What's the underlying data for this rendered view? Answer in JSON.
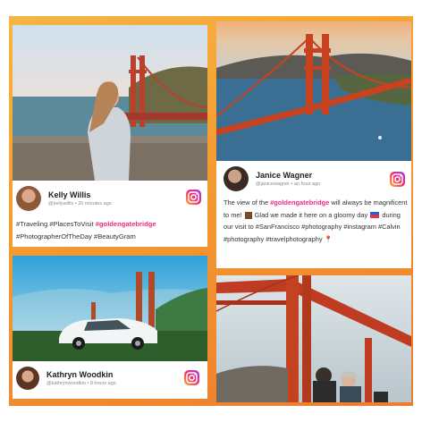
{
  "posts": [
    {
      "name": "Kelly Willis",
      "handle": "@kellywillis",
      "time": "20 minutes ago",
      "caption": {
        "tag1": "#Traveling",
        "tag2": "#PlacesToVisit",
        "tag3": "#goldengatebridge",
        "tag4": "#PhotographerOfTheDay",
        "tag5": "#BeautyGram"
      }
    },
    {
      "name": "Janice Wagner",
      "handle": "@janicewagner",
      "time": "an hour ago",
      "caption": {
        "pre": "The view of the",
        "highlight": "#goldengatebridge",
        "mid1": "will always be magnificent to me!",
        "mid2": "Glad we made it here on a gloomy day",
        "mid3": "during our visit to",
        "tags": "#SanFrancisco #photography #instagram #Calvin #photography #travelphotography"
      }
    },
    {
      "name": "Kathryn Woodkin",
      "handle": "@kathrynwoodkin",
      "time": "8 hours ago"
    }
  ],
  "icons": {
    "instagram": "instagram-icon",
    "flag": "flag-icon",
    "emoji": "emoji-icon",
    "pin": "pushpin-icon"
  },
  "colors": {
    "background": "#f39a30",
    "hashtag_highlight": "#ee2a7b"
  }
}
